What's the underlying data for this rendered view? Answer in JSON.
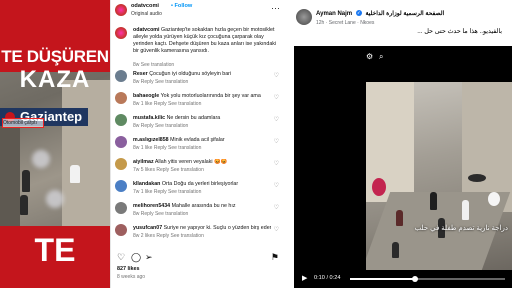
{
  "left": {
    "headline_top": "TE DÜŞÜREN",
    "headline_main": "KAZA",
    "city": "Gaziantep",
    "bottom_text": "TE",
    "overlay_caption": "Otomobil çarptı"
  },
  "instagram": {
    "username": "odatvcomi",
    "follow": "• Follow",
    "audio": "Original audio",
    "caption_user": "odatvcomi",
    "caption_text": "Gaziantep'te sokaktan hızla geçen bir motosiklet aileyle yolda yürüyen küçük kız çocuğuna çarparak olay yerinden kaçtı. Dehşete düşüren bu kaza anları ise yakındaki bir güvenlik kamerasına yansıdı.",
    "caption_meta": "8w   See translation",
    "comments": [
      {
        "user": "Reser",
        "text": "Çocuğun iyi olduğunu söyleyin bari",
        "meta": "8w   Reply   See translation",
        "color": "#6b7d8f"
      },
      {
        "user": "bahaeogle",
        "text": "Yok yolu motorluolarınında bir şey var ama",
        "meta": "8w   1 like   Reply   See translation",
        "color": "#b9795a"
      },
      {
        "user": "mustafa.kilic",
        "text": "Ne dersin bu adamlara",
        "meta": "8w   Reply   See translation",
        "color": "#5f8a62"
      },
      {
        "user": "m.aslıgızel858",
        "text": "Minik evlada acil şifalar",
        "meta": "8w   1 like   Reply   See translation",
        "color": "#8a5f9e"
      },
      {
        "user": "aiyilmaz",
        "text": "Allah yitis veren veyalaki 😡😡",
        "meta": "7w   5 likes   Reply   See translation",
        "color": "#c59a4b"
      },
      {
        "user": "kllandakan",
        "text": "Orta Doğu da yerleri birleşiyorlar",
        "meta": "7w   1 like   Reply   See translation",
        "color": "#4b7fc5"
      },
      {
        "user": "melihoren5434",
        "text": "Mahalle arasında bu ne hız",
        "meta": "8w   Reply   See translation",
        "color": "#7a7a7a"
      },
      {
        "user": "yusufcan07",
        "text": "Suriye ne yapıyor ki. Suçlu o yüzden birş ederlerdi",
        "meta": "8w   2 likes   Reply   See translation",
        "color": "#9e5f5f"
      }
    ],
    "likes": "827 likes",
    "date": "8 weeks ago"
  },
  "facebook": {
    "page_name": "Ayman Najm",
    "page_arabic": "الصفحة الرسمية لوزارة الداخلية",
    "time": "12h · Secret Lane · Nkoes",
    "caption": "بالفيديو.. هذا ما حدث حتى حل ...",
    "video_caption": "دراجة نارية تصدم طفلة في حلب",
    "time_display": "0:10 / 0:24",
    "progress": 0.42
  },
  "colors": {
    "ig_blue": "#0095f6",
    "fb_blue": "#1877f2",
    "news_red": "#c4151c"
  }
}
